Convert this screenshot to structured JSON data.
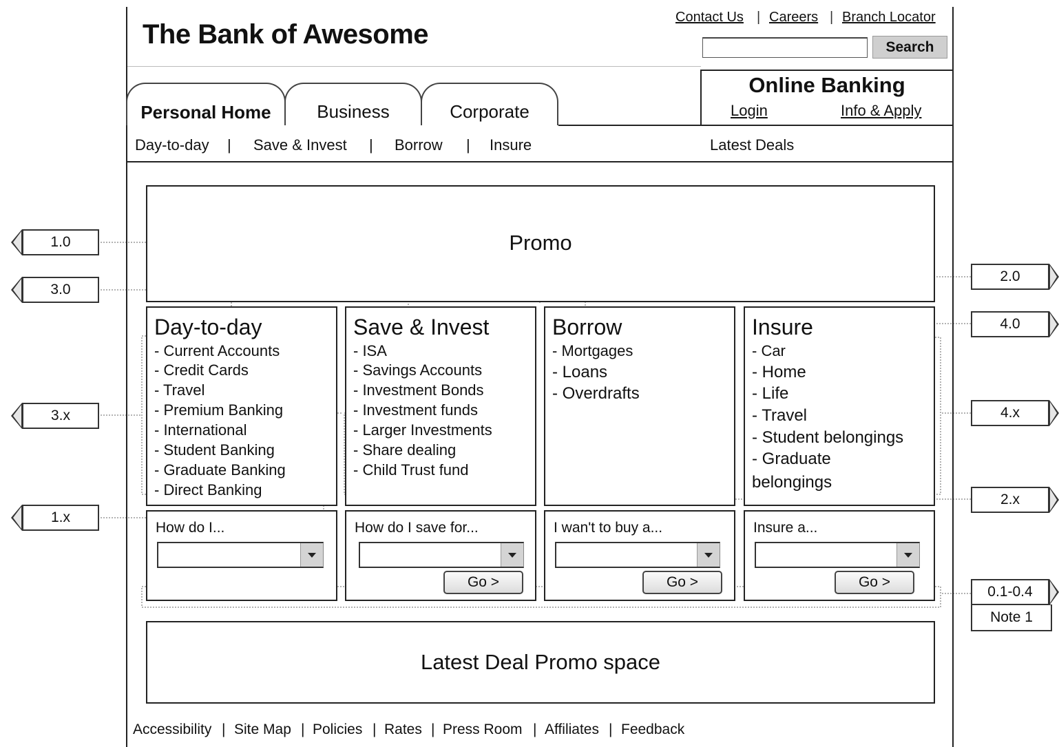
{
  "header": {
    "title": "The Bank of Awesome",
    "util_links": [
      "Contact Us",
      "Careers",
      "Branch Locator"
    ],
    "util_sep": "|",
    "search_value": "",
    "search_button": "Search"
  },
  "tabs": [
    "Personal Home",
    "Business",
    "Corporate"
  ],
  "online_banking": {
    "title": "Online Banking",
    "login": "Login",
    "info": "Info & Apply"
  },
  "subnav": {
    "items": [
      "Day-to-day",
      "Save & Invest",
      "Borrow",
      "Insure"
    ],
    "sep": "|",
    "latest": "Latest Deals"
  },
  "promo": "Promo",
  "columns": [
    {
      "title": "Day-to-day",
      "items": [
        "- Current Accounts",
        "- Credit Cards",
        "- Travel",
        "- Premium Banking",
        "- International",
        "- Student Banking",
        "- Graduate Banking",
        "- Direct  Banking"
      ],
      "question": "How do I...",
      "select_value": "",
      "go": ""
    },
    {
      "title": "Save & Invest",
      "items": [
        "- ISA",
        "- Savings Accounts",
        "- Investment Bonds",
        "- Investment funds",
        "- Larger Investments",
        "- Share dealing",
        "- Child Trust fund"
      ],
      "question": "How do I save for...",
      "select_value": "",
      "go": "Go >"
    },
    {
      "title": "Borrow",
      "items": [
        "- Mortgages",
        "- Loans",
        "- Overdrafts"
      ],
      "question": "I wan't to buy a...",
      "select_value": "",
      "go": "Go >"
    },
    {
      "title": "Insure",
      "items": [
        "- Car",
        "- Home",
        "- Life",
        "- Travel",
        "- Student belongings",
        "- Graduate",
        "belongings"
      ],
      "question": "Insure a...",
      "select_value": "",
      "go": "Go >"
    }
  ],
  "latest_promo": "Latest Deal Promo space",
  "footer": {
    "links": [
      "Accessibility",
      "Site Map",
      "Policies",
      "Rates",
      "Press Room",
      "Affiliates",
      "Feedback"
    ],
    "sep": "|"
  },
  "callouts": {
    "c10": "1.0",
    "c30": "3.0",
    "c3x": "3.x",
    "c1x": "1.x",
    "c20": "2.0",
    "c40": "4.0",
    "c4x": "4.x",
    "c2x": "2.x",
    "c01": "0.1-0.4",
    "note": "Note 1"
  }
}
